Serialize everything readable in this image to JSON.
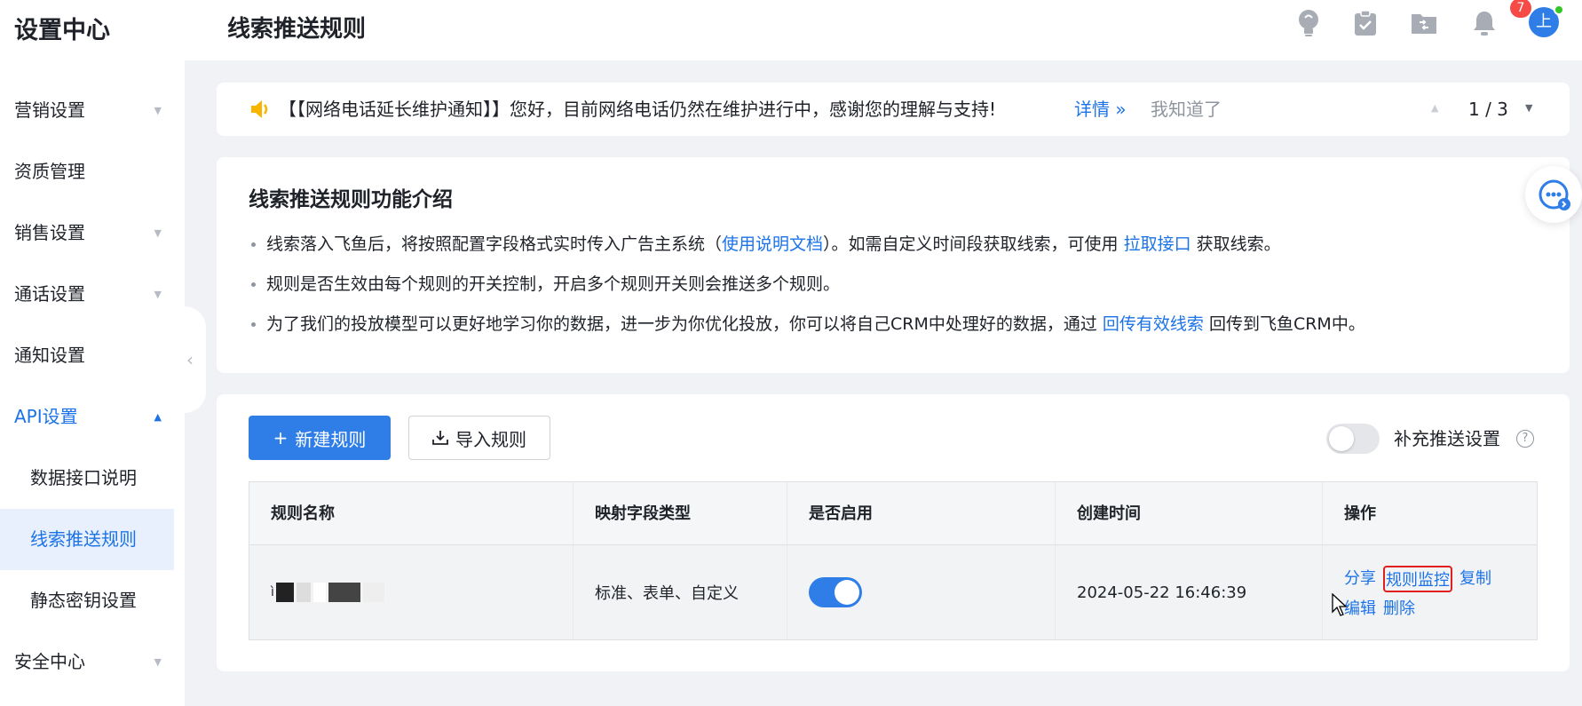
{
  "sidebar": {
    "title": "设置中心",
    "items": [
      {
        "label": "营销设置",
        "caret": "▼"
      },
      {
        "label": "资质管理",
        "caret": ""
      },
      {
        "label": "销售设置",
        "caret": "▼"
      },
      {
        "label": "通话设置",
        "caret": "▼"
      },
      {
        "label": "通知设置",
        "caret": ""
      },
      {
        "label": "API设置",
        "caret": "▲"
      },
      {
        "label": "数据接口说明",
        "caret": ""
      },
      {
        "label": "线索推送规则",
        "caret": ""
      },
      {
        "label": "静态密钥设置",
        "caret": ""
      },
      {
        "label": "安全中心",
        "caret": "▼"
      }
    ],
    "collapse_glyph": "‹"
  },
  "header": {
    "title": "线索推送规则",
    "notification_count": "7",
    "avatar_text": "上"
  },
  "notice": {
    "text": "【【网络电话延长维护通知】】您好，目前网络电话仍然在维护进行中，感谢您的理解与支持!",
    "detail_link": "详情 »",
    "dismiss": "我知道了",
    "page": "1 / 3",
    "prev_glyph": "▲",
    "next_glyph": "▼"
  },
  "intro": {
    "title": "线索推送规则功能介绍",
    "bullet1": {
      "pre": "线索落入飞鱼后，将按照配置字段格式实时传入广告主系统（",
      "link1": "使用说明文档",
      "mid": "）。如需自定义时间段获取线索，可使用 ",
      "link2": "拉取接口",
      "post": " 获取线索。"
    },
    "bullet2": "规则是否生效由每个规则的开关控制，开启多个规则开关则会推送多个规则。",
    "bullet3": {
      "pre": "为了我们的投放模型可以更好地学习你的数据，进一步为你优化投放，你可以将自己CRM中处理好的数据，通过 ",
      "link": "回传有效线索",
      "post": " 回传到飞鱼CRM中。"
    }
  },
  "toolbar": {
    "new_rule": "新建规则",
    "new_rule_glyph": "+",
    "import_rule": "导入规则",
    "supplement_label": "补充推送设置",
    "help_glyph": "?"
  },
  "table": {
    "headers": [
      "规则名称",
      "映射字段类型",
      "是否启用",
      "创建时间",
      "操作"
    ],
    "rows": [
      {
        "name_prefix": "ì",
        "field_type": "标准、表单、自定义",
        "enabled": true,
        "created": "2024-05-22 16:46:39",
        "actions": [
          "分享",
          "规则监控",
          "复制",
          "编辑",
          "删除"
        ]
      }
    ]
  },
  "colors": {
    "primary": "#2f7ee8",
    "link": "#1c73e8",
    "highlight_border": "#e02020",
    "badge": "#f54a45"
  }
}
